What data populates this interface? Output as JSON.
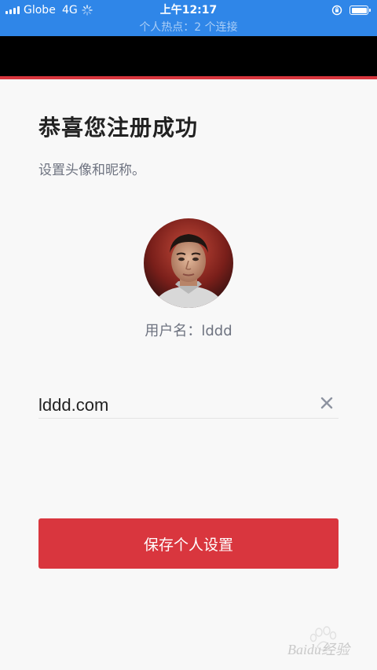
{
  "status_bar": {
    "carrier": "Globe",
    "network": "4G",
    "time": "上午12:17",
    "hotspot_text": "个人热点：2 个连接"
  },
  "page": {
    "title": "恭喜您注册成功",
    "subtitle": "设置头像和昵称。",
    "username_label": "用户名：",
    "username_value": "lddd"
  },
  "nickname_input": {
    "value": "lddd.com",
    "placeholder": ""
  },
  "save_button": {
    "label": "保存个人设置"
  },
  "watermark": {
    "text": "Baidu经验"
  },
  "colors": {
    "status_bar": "#2f86e8",
    "accent_red": "#d9363e",
    "title_text": "#222222",
    "muted_text": "#6e7380"
  },
  "icons": {
    "clear": "close-icon",
    "avatar": "user-avatar-photo"
  }
}
